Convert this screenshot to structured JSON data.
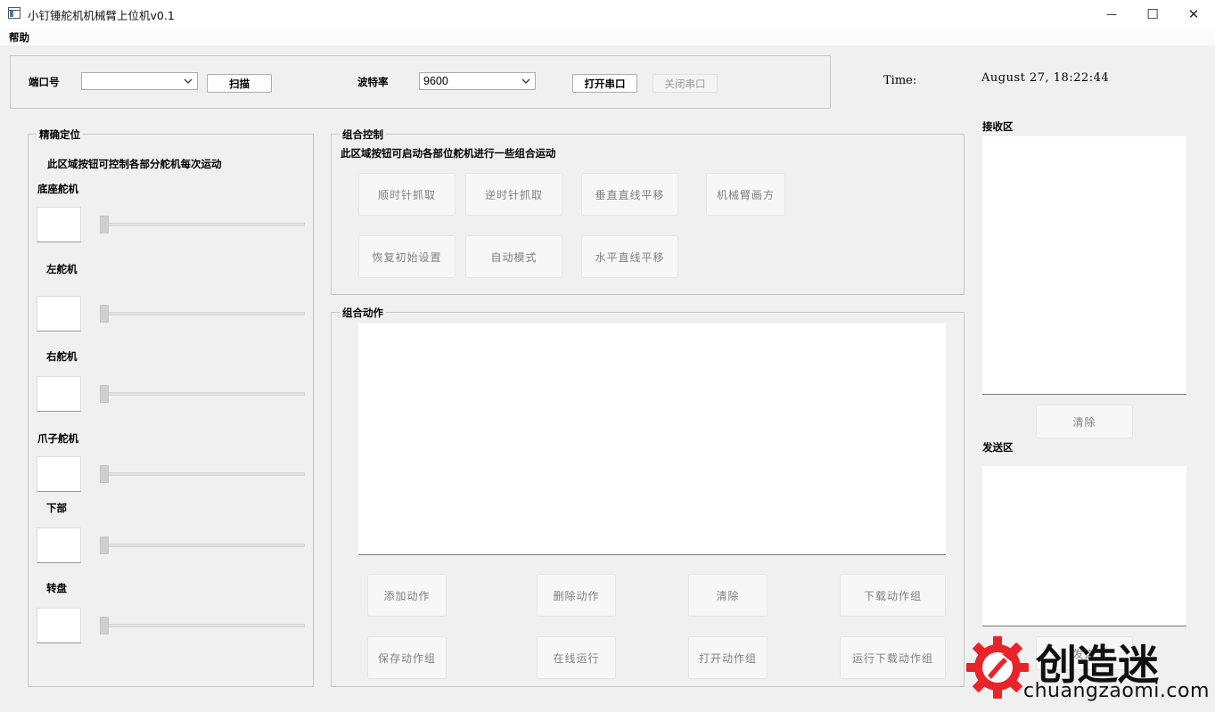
{
  "window": {
    "title": "小钉锤舵机机械臂上位机v0.1",
    "minimize_glyph": "—",
    "maximize_glyph": "☐",
    "close_glyph": "✕"
  },
  "menu": {
    "help": "帮助"
  },
  "serial": {
    "port_label": "端口号",
    "port_value": "",
    "scan_button": "扫描",
    "baud_label": "波特率",
    "baud_value": "9600",
    "open_button": "打开串口",
    "close_button": "关闭串口"
  },
  "time": {
    "label": "Time:",
    "value": "August 27, 18:22:44"
  },
  "precise": {
    "title": "精确定位",
    "description": "此区域按钮可控制各部分舵机每次运动",
    "servos": [
      {
        "label": "底座舵机",
        "value": "",
        "level": 0
      },
      {
        "label": "左舵机",
        "value": "",
        "level": 0
      },
      {
        "label": "右舵机",
        "value": "",
        "level": 0
      },
      {
        "label": "爪子舵机",
        "value": "",
        "level": 0
      },
      {
        "label": "下部",
        "value": "",
        "level": 0
      },
      {
        "label": "转盘",
        "value": "",
        "level": 0
      }
    ]
  },
  "combo_control": {
    "title": "组合控制",
    "description": "此区域按钮可启动各部位舵机进行一些组合运动",
    "buttons": [
      "顺时针抓取",
      "逆时针抓取",
      "垂直直线平移",
      "机械臂画方",
      "恢复初始设置",
      "自动模式",
      "水平直线平移"
    ]
  },
  "combo_action": {
    "title": "组合动作",
    "list_content": "",
    "buttons": [
      "添加动作",
      "删除动作",
      "清除",
      "下载动作组",
      "保存动作组",
      "在线运行",
      "打开动作组",
      "运行下载动作组"
    ]
  },
  "receive": {
    "title": "接收区",
    "content": "",
    "clear_button": "清除"
  },
  "send": {
    "title": "发送区",
    "content": "",
    "send_button": "发送"
  },
  "watermark": {
    "text": "创造迷",
    "url": "chuangzaomi.com",
    "color": "#e8232a"
  }
}
